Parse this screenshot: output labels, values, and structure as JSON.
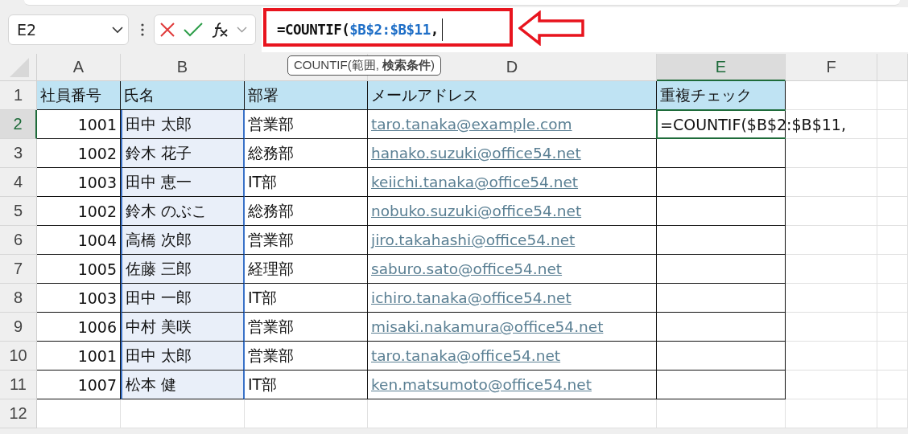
{
  "name_box": {
    "value": "E2"
  },
  "formula_bar": {
    "parts": [
      {
        "text": "=COUNTIF(",
        "kind": "plain"
      },
      {
        "text": "$B$2:$B$11",
        "kind": "reference"
      },
      {
        "text": ",",
        "kind": "plain"
      }
    ]
  },
  "tooltip": "COUNTIF(範囲, **検索条件**)",
  "columns": [
    {
      "label": "A",
      "selected": false
    },
    {
      "label": "B",
      "selected": false
    },
    {
      "selected": false
    },
    {
      "label": "D",
      "selected": false
    },
    {
      "label": "E",
      "selected": true
    },
    {
      "label": "F",
      "selected": false
    }
  ],
  "rows": [
    {
      "number": "1",
      "selected": false,
      "kind": "header",
      "cells": [
        "社員番号",
        "氏名",
        "部署",
        "メールアドレス",
        "重複チェック"
      ]
    },
    {
      "number": "2",
      "selected": true,
      "kind": "data",
      "in_reference": true,
      "cells": [
        "1001",
        "田中 太郎",
        "営業部",
        "taro.tanaka@example.com",
        "=COUNTIF($B$2:$B$11,"
      ]
    },
    {
      "number": "3",
      "selected": false,
      "kind": "data",
      "in_reference": true,
      "cells": [
        "1002",
        "鈴木 花子",
        "総務部",
        "hanako.suzuki@office54.net"
      ]
    },
    {
      "number": "4",
      "selected": false,
      "kind": "data",
      "in_reference": true,
      "cells": [
        "1003",
        "田中 恵一",
        "IT部",
        "keiichi.tanaka@office54.net"
      ]
    },
    {
      "number": "5",
      "selected": false,
      "kind": "data",
      "in_reference": true,
      "cells": [
        "1002",
        "鈴木 のぶこ",
        "総務部",
        "nobuko.suzuki@office54.net"
      ]
    },
    {
      "number": "6",
      "selected": false,
      "kind": "data",
      "in_reference": true,
      "cells": [
        "1004",
        "高橋 次郎",
        "営業部",
        "jiro.takahashi@office54.net"
      ]
    },
    {
      "number": "7",
      "selected": false,
      "kind": "data",
      "in_reference": true,
      "cells": [
        "1005",
        "佐藤 三郎",
        "経理部",
        "saburo.sato@office54.net"
      ]
    },
    {
      "number": "8",
      "selected": false,
      "kind": "data",
      "in_reference": true,
      "cells": [
        "1003",
        "田中 一郎",
        "IT部",
        "ichiro.tanaka@office54.net"
      ]
    },
    {
      "number": "9",
      "selected": false,
      "kind": "data",
      "in_reference": true,
      "cells": [
        "1006",
        "中村 美咲",
        "営業部",
        "misaki.nakamura@office54.net"
      ]
    },
    {
      "number": "10",
      "selected": false,
      "kind": "data",
      "in_reference": true,
      "cells": [
        "1001",
        "田中 太郎",
        "営業部",
        "taro.tanaka@office54.net"
      ]
    },
    {
      "number": "11",
      "selected": false,
      "kind": "data",
      "in_reference": true,
      "cells": [
        "1007",
        "松本 健",
        "IT部",
        "ken.matsumoto@office54.net"
      ]
    },
    {
      "number": "12",
      "selected": false,
      "kind": "empty",
      "cells": []
    }
  ]
}
